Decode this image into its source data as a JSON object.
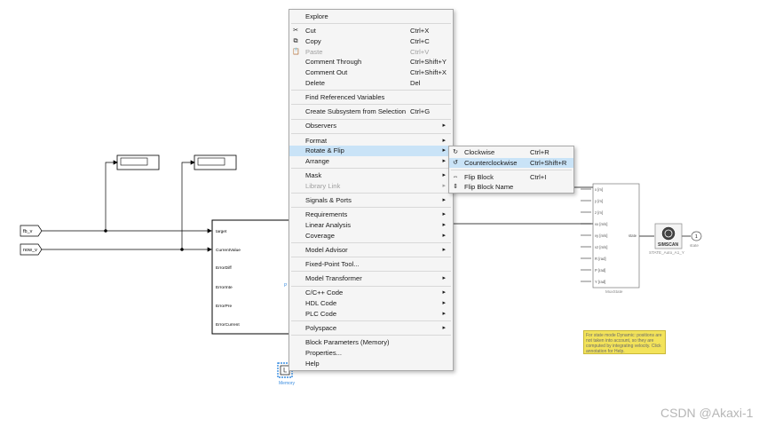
{
  "diagram": {
    "inports": [
      {
        "label": "fb_v"
      },
      {
        "label": "now_v"
      }
    ],
    "pid_block": {
      "ports": [
        "target",
        "CurrentValue",
        "ErrorDiff",
        "ErrorInte",
        "ErrorPre",
        "ErrorCurrent"
      ],
      "small_label": "P"
    },
    "memory_block": {
      "label": "Memory"
    },
    "mux_block": {
      "ports": [
        "x [m]",
        "y [m]",
        "z [m]",
        "vx [m/s]",
        "vy [m/s]",
        "vz [m/s]",
        "R [rad]",
        "P [rad]",
        "Y [rad]"
      ],
      "caption": "MuxState",
      "out_label": "state"
    },
    "scope_block": {
      "brand": "SIMSCAN",
      "caption": "STATE_Auto_A1_Y"
    },
    "outport": {
      "number": "1",
      "caption": "state"
    },
    "annotation": "For state mode Dynamic: positions are not taken into account, so they are computed by integrating velocity. Click annotation for Help."
  },
  "context_menu": {
    "items": [
      {
        "type": "item",
        "label": "Explore"
      },
      {
        "type": "sep"
      },
      {
        "type": "item",
        "label": "Cut",
        "shortcut": "Ctrl+X",
        "icon": "scissors-icon",
        "glyph": "✂"
      },
      {
        "type": "item",
        "label": "Copy",
        "shortcut": "Ctrl+C",
        "icon": "copy-icon",
        "glyph": "⧉"
      },
      {
        "type": "item",
        "label": "Paste",
        "shortcut": "Ctrl+V",
        "icon": "paste-icon",
        "glyph": "📋",
        "disabled": true
      },
      {
        "type": "item",
        "label": "Comment Through",
        "shortcut": "Ctrl+Shift+Y"
      },
      {
        "type": "item",
        "label": "Comment Out",
        "shortcut": "Ctrl+Shift+X"
      },
      {
        "type": "item",
        "label": "Delete",
        "shortcut": "Del"
      },
      {
        "type": "sep"
      },
      {
        "type": "item",
        "label": "Find Referenced Variables"
      },
      {
        "type": "sep"
      },
      {
        "type": "item",
        "label": "Create Subsystem from Selection",
        "shortcut": "Ctrl+G"
      },
      {
        "type": "sep"
      },
      {
        "type": "item",
        "label": "Observers",
        "submenu": true
      },
      {
        "type": "sep"
      },
      {
        "type": "item",
        "label": "Format",
        "submenu": true
      },
      {
        "type": "item",
        "label": "Rotate & Flip",
        "submenu": true,
        "highlighted": true
      },
      {
        "type": "item",
        "label": "Arrange",
        "submenu": true
      },
      {
        "type": "sep"
      },
      {
        "type": "item",
        "label": "Mask",
        "submenu": true
      },
      {
        "type": "item",
        "label": "Library Link",
        "submenu": true,
        "disabled": true
      },
      {
        "type": "sep"
      },
      {
        "type": "item",
        "label": "Signals & Ports",
        "submenu": true
      },
      {
        "type": "sep"
      },
      {
        "type": "item",
        "label": "Requirements",
        "submenu": true
      },
      {
        "type": "item",
        "label": "Linear Analysis",
        "submenu": true
      },
      {
        "type": "item",
        "label": "Coverage",
        "submenu": true
      },
      {
        "type": "sep"
      },
      {
        "type": "item",
        "label": "Model Advisor",
        "submenu": true
      },
      {
        "type": "sep"
      },
      {
        "type": "item",
        "label": "Fixed-Point Tool..."
      },
      {
        "type": "sep"
      },
      {
        "type": "item",
        "label": "Model Transformer",
        "submenu": true
      },
      {
        "type": "sep"
      },
      {
        "type": "item",
        "label": "C/C++ Code",
        "submenu": true
      },
      {
        "type": "item",
        "label": "HDL Code",
        "submenu": true
      },
      {
        "type": "item",
        "label": "PLC Code",
        "submenu": true
      },
      {
        "type": "sep"
      },
      {
        "type": "item",
        "label": "Polyspace",
        "submenu": true
      },
      {
        "type": "sep"
      },
      {
        "type": "item",
        "label": "Block Parameters (Memory)"
      },
      {
        "type": "item",
        "label": "Properties..."
      },
      {
        "type": "item",
        "label": "Help"
      }
    ]
  },
  "submenu": {
    "items": [
      {
        "type": "item",
        "label": "Clockwise",
        "shortcut": "Ctrl+R",
        "icon": "rotate-clockwise-icon",
        "glyph": "↻"
      },
      {
        "type": "item",
        "label": "Counterclockwise",
        "shortcut": "Ctrl+Shift+R",
        "icon": "rotate-counterclockwise-icon",
        "glyph": "↺",
        "highlighted": true
      },
      {
        "type": "sep"
      },
      {
        "type": "item",
        "label": "Flip Block",
        "shortcut": "Ctrl+I",
        "icon": "flip-block-icon",
        "glyph": "⇔"
      },
      {
        "type": "item",
        "label": "Flip Block Name",
        "icon": "flip-name-icon",
        "glyph": "⇕"
      }
    ]
  },
  "watermark": "CSDN @Akaxi-1",
  "colors": {
    "highlight": "#c9e3f7",
    "menu_bg": "#f5f5f5",
    "selection_blue": "#3c8ee0",
    "annotation_bg": "#f3e35a"
  }
}
